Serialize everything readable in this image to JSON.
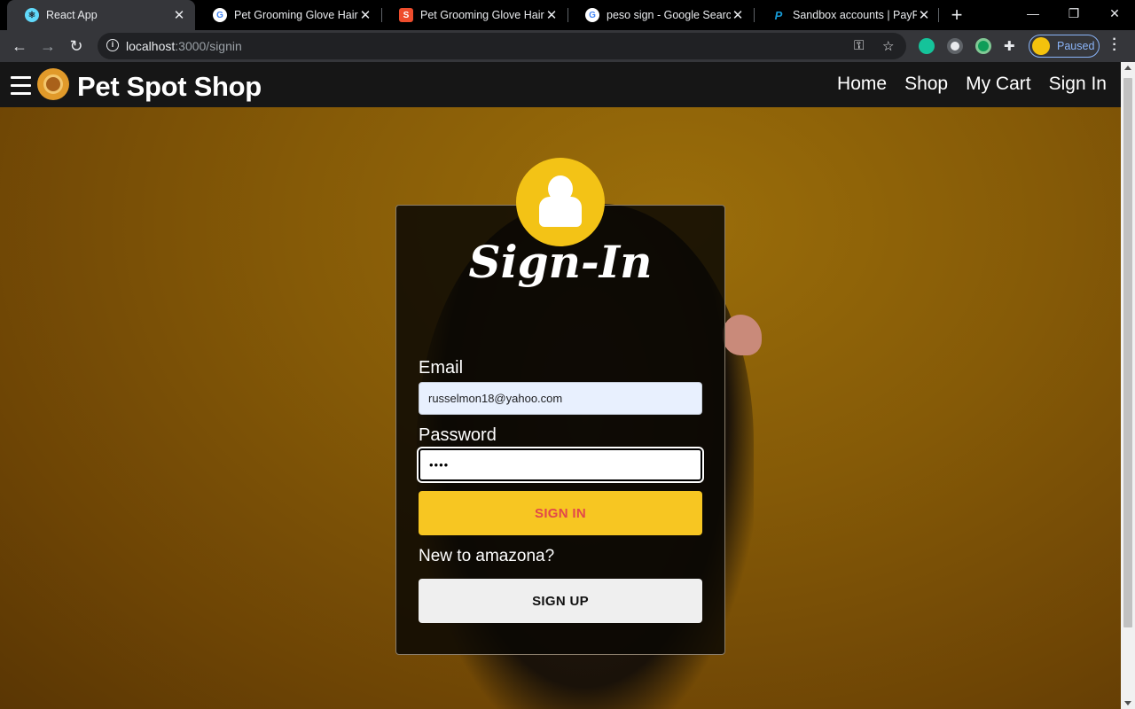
{
  "browser": {
    "tabs": [
      {
        "title": "React App",
        "active": true,
        "favicon": "react-icon"
      },
      {
        "title": "Pet Grooming Glove Hair Re",
        "active": false,
        "favicon": "google-icon"
      },
      {
        "title": "Pet Grooming Glove Hair Re",
        "active": false,
        "favicon": "shopee-icon"
      },
      {
        "title": "peso sign - Google Search",
        "active": false,
        "favicon": "google-icon"
      },
      {
        "title": "Sandbox accounts | PayPal D",
        "active": false,
        "favicon": "paypal-icon"
      }
    ],
    "url_host": "localhost",
    "url_path": ":3000/signin",
    "profile_label": "Paused",
    "colors": {
      "tabstrip": "#000000",
      "toolbar": "#35363a",
      "omnibox": "#202124"
    }
  },
  "app": {
    "brand": "Pet Spot Shop",
    "nav": [
      "Home",
      "Shop",
      "My Cart",
      "Sign In"
    ]
  },
  "signin": {
    "title": "Sign-In",
    "email_label": "Email",
    "email_value": "russelmon18@yahoo.com",
    "password_label": "Password",
    "password_mask": "••••",
    "signin_button": "SIGN IN",
    "new_prompt": "New to amazona?",
    "signup_button": "SIGN UP",
    "colors": {
      "accent": "#f7c622",
      "signin_text": "#e2484a",
      "avatar": "#f3c316"
    }
  }
}
